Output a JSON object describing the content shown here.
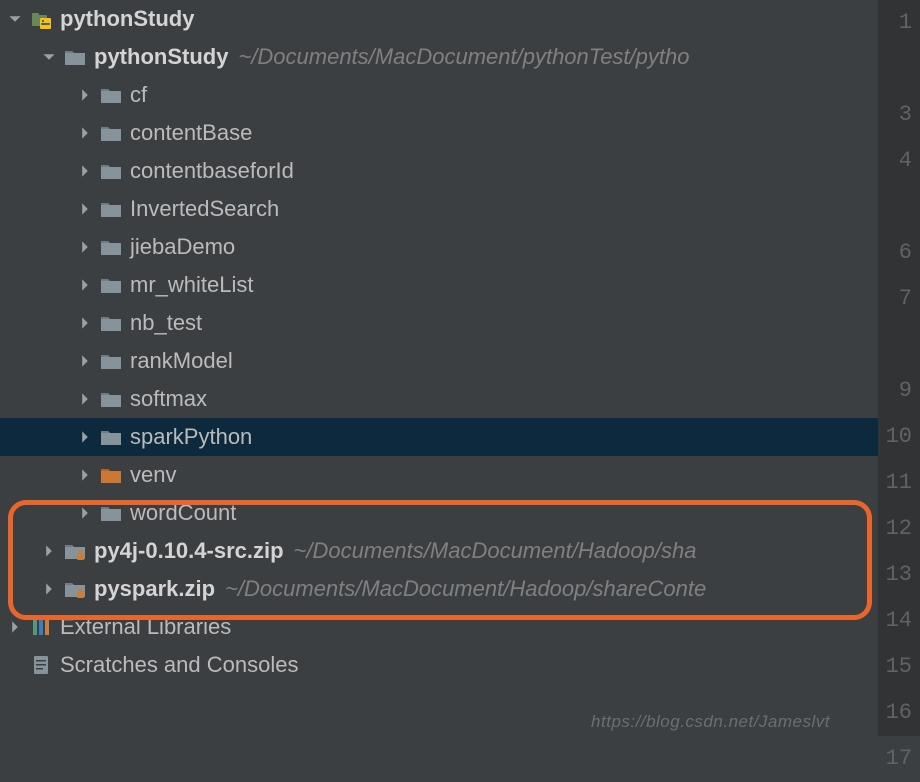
{
  "project": {
    "root_label": "pythonStudy",
    "module": {
      "label": "pythonStudy",
      "hint": "~/Documents/MacDocument/pythonTest/pytho",
      "folders": [
        {
          "label": "cf"
        },
        {
          "label": "contentBase"
        },
        {
          "label": "contentbaseforId"
        },
        {
          "label": "InvertedSearch"
        },
        {
          "label": "jiebaDemo"
        },
        {
          "label": "mr_whiteList"
        },
        {
          "label": "nb_test"
        },
        {
          "label": "rankModel"
        },
        {
          "label": "softmax"
        },
        {
          "label": "sparkPython",
          "selected": true
        },
        {
          "label": "venv",
          "excluded": true
        },
        {
          "label": "wordCount"
        }
      ]
    },
    "zips": [
      {
        "label": "py4j-0.10.4-src.zip",
        "hint": "~/Documents/MacDocument/Hadoop/sha"
      },
      {
        "label": "pyspark.zip",
        "hint": "~/Documents/MacDocument/Hadoop/shareConte"
      }
    ],
    "external_label": "External Libraries",
    "scratches_label": "Scratches and Consoles"
  },
  "gutter": {
    "lines": [
      "1",
      "",
      "3",
      "4",
      "",
      "6",
      "7",
      "",
      "9",
      "10",
      "11",
      "12",
      "13",
      "14",
      "15",
      "16",
      "17"
    ]
  },
  "watermark": "https://blog.csdn.net/Jameslvt"
}
